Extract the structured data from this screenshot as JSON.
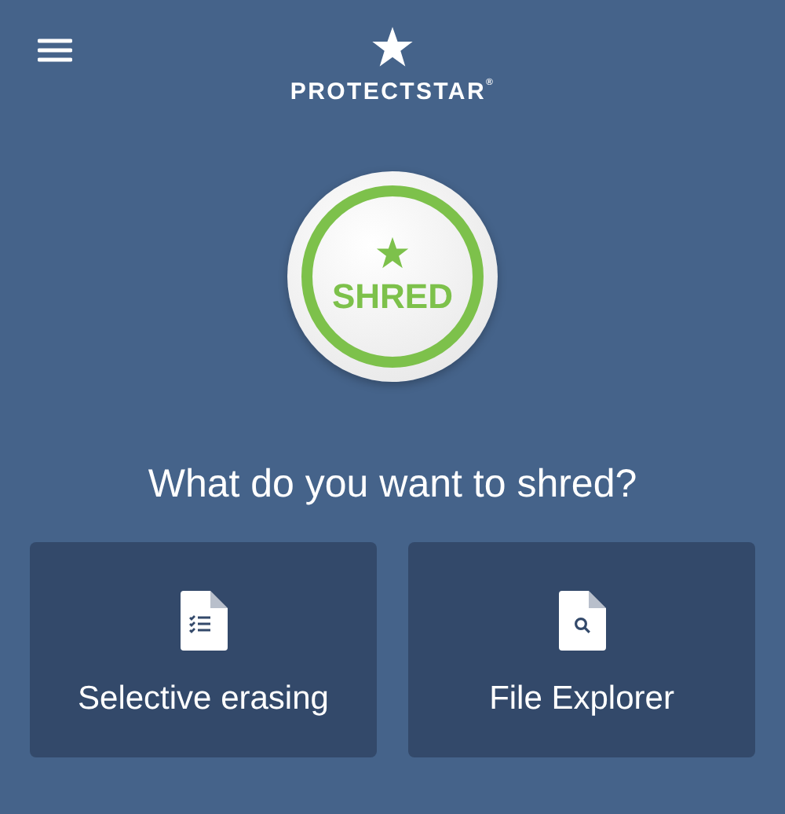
{
  "header": {
    "brand": "PROTECTSTAR$^{®}$"
  },
  "shred_button": {
    "label": "SHRED"
  },
  "heading": "What do you want to shred?",
  "options": [
    {
      "kind": "checklist",
      "label": "Selective erasing"
    },
    {
      "kind": "search",
      "label": "File Explorer"
    }
  ]
}
